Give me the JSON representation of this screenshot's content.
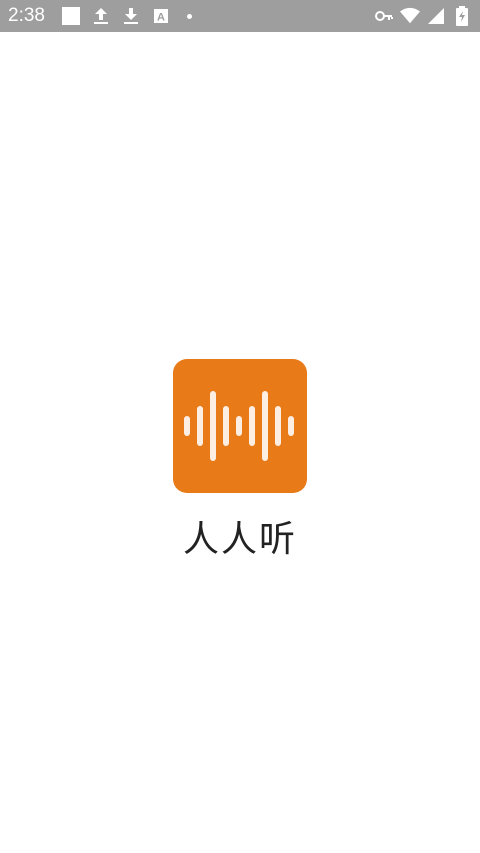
{
  "status_bar": {
    "time": "2:38",
    "icons_left": [
      "square-notification-icon",
      "upload-icon",
      "download-icon",
      "text-app-icon",
      "dot-icon"
    ],
    "icons_right": [
      "vpn-key-icon",
      "wifi-icon",
      "signal-icon",
      "battery-charging-icon"
    ]
  },
  "splash": {
    "app_name": "人人听",
    "logo_icon": "audio-waveform-icon",
    "logo_color": "#e87a17",
    "text_app_icon_letter": "A"
  }
}
